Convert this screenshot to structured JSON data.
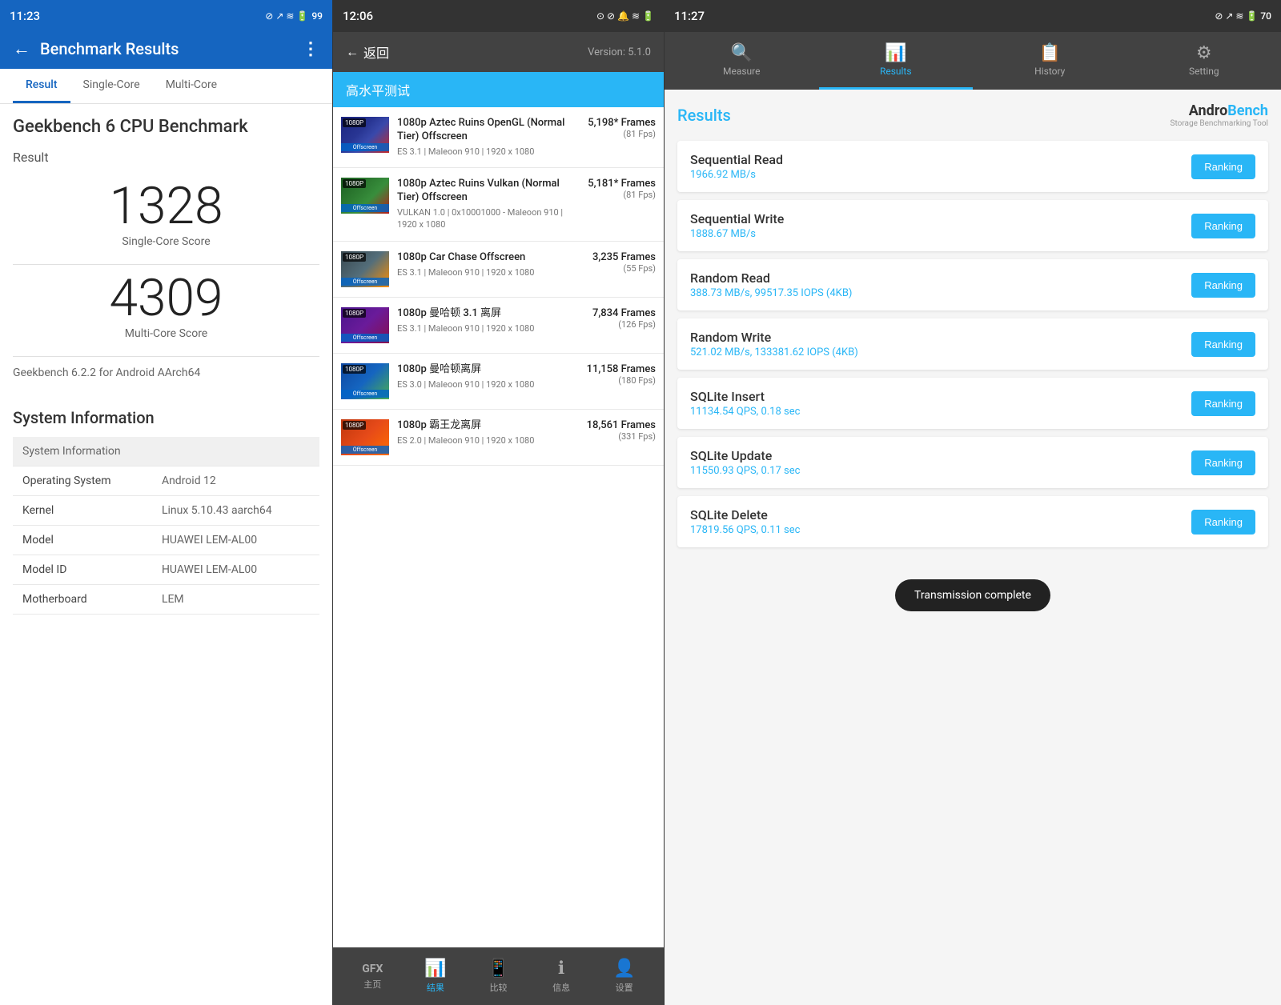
{
  "panel1": {
    "status_bar": {
      "time": "11:23",
      "icons": "⊘ ↗ ≋ 🔋 99"
    },
    "header": {
      "title": "Benchmark Results",
      "back": "←",
      "more": "⋮"
    },
    "tabs": [
      {
        "label": "Result",
        "active": true
      },
      {
        "label": "Single-Core",
        "active": false
      },
      {
        "label": "Multi-Core",
        "active": false
      }
    ],
    "benchmark_title": "Geekbench 6 CPU Benchmark",
    "result_label": "Result",
    "single_core_score": "1328",
    "single_core_label": "Single-Core Score",
    "multi_core_score": "4309",
    "multi_core_label": "Multi-Core Score",
    "version_info": "Geekbench 6.2.2 for Android AArch64",
    "system_info_heading": "System Information",
    "sys_table_header": "System Information",
    "sys_rows": [
      {
        "label": "Operating System",
        "value": "Android 12"
      },
      {
        "label": "Kernel",
        "value": "Linux 5.10.43 aarch64"
      },
      {
        "label": "Model",
        "value": "HUAWEI LEM-AL00"
      },
      {
        "label": "Model ID",
        "value": "HUAWEI LEM-AL00"
      },
      {
        "label": "Motherboard",
        "value": "LEM"
      }
    ]
  },
  "panel2": {
    "status_bar": {
      "time": "12:06",
      "icons": "⊙ ⊘ 🔔 ≋ 🔋 □□"
    },
    "header": {
      "back_label": "返回",
      "version": "Version: 5.1.0"
    },
    "subtitle": "高水平测试",
    "items": [
      {
        "name": "1080p Aztec Ruins OpenGL (Normal Tier) Offscreen",
        "spec": "ES 3.1 | Maleoon 910 | 1920 x 1080",
        "frames": "5,198* Frames",
        "fps": "(81 Fps)",
        "thumb_class": "img-aztec",
        "res": "1080P",
        "tag": "Offscreen"
      },
      {
        "name": "1080p Aztec Ruins Vulkan (Normal Tier) Offscreen",
        "spec": "VULKAN 1.0 | 0x10001000 - Maleoon 910 | 1920 x 1080",
        "frames": "5,181* Frames",
        "fps": "(81 Fps)",
        "thumb_class": "img-aztec2",
        "res": "1080P",
        "tag": "Offscreen"
      },
      {
        "name": "1080p Car Chase Offscreen",
        "spec": "ES 3.1 | Maleoon 910 | 1920 x 1080",
        "frames": "3,235 Frames",
        "fps": "(55 Fps)",
        "thumb_class": "img-car",
        "res": "1080P",
        "tag": "Offscreen"
      },
      {
        "name": "1080p 曼哈顿 3.1 离屏",
        "spec": "ES 3.1 | Maleoon 910 | 1920 x 1080",
        "frames": "7,834 Frames",
        "fps": "(126 Fps)",
        "thumb_class": "img-chinese",
        "res": "1080P",
        "tag": "Offscreen"
      },
      {
        "name": "1080p 曼哈顿离屏",
        "spec": "ES 3.0 | Maleoon 910 | 1920 x 1080",
        "frames": "11,158 Frames",
        "fps": "(180 Fps)",
        "thumb_class": "img-chinese2",
        "res": "1080P",
        "tag": "Offscreen"
      },
      {
        "name": "1080p 霸王龙离屏",
        "spec": "ES 2.0 | Maleoon 910 | 1920 x 1080",
        "frames": "18,561 Frames",
        "fps": "(331 Fps)",
        "thumb_class": "img-dragon",
        "res": "1080P",
        "tag": "Offscreen"
      }
    ],
    "bottom_nav": [
      {
        "label": "主页",
        "icon": "GFX",
        "active": false,
        "is_text": true
      },
      {
        "label": "结果",
        "icon": "📊",
        "active": true
      },
      {
        "label": "比较",
        "icon": "📱",
        "active": false
      },
      {
        "label": "信息",
        "icon": "ℹ",
        "active": false
      },
      {
        "label": "设置",
        "icon": "👤",
        "active": false
      }
    ]
  },
  "panel3": {
    "status_bar": {
      "time": "11:27",
      "icons": "⊘ ↗ ≋ 🔋 70"
    },
    "tabs": [
      {
        "label": "Measure",
        "icon": "🔍",
        "active": false
      },
      {
        "label": "Results",
        "icon": "📊",
        "active": true
      },
      {
        "label": "History",
        "icon": "📋",
        "active": false
      },
      {
        "label": "Setting",
        "icon": "⚙",
        "active": false
      }
    ],
    "results_title": "Results",
    "logo": {
      "main": "AndroBench",
      "sub": "Storage Benchmarking Tool"
    },
    "metrics": [
      {
        "name": "Sequential Read",
        "value": "1966.92 MB/s",
        "btn": "Ranking"
      },
      {
        "name": "Sequential Write",
        "value": "1888.67 MB/s",
        "btn": "Ranking"
      },
      {
        "name": "Random Read",
        "value": "388.73 MB/s, 99517.35 IOPS (4KB)",
        "btn": "Ranking"
      },
      {
        "name": "Random Write",
        "value": "521.02 MB/s, 133381.62 IOPS (4KB)",
        "btn": "Ranking"
      },
      {
        "name": "SQLite Insert",
        "value": "11134.54 QPS, 0.18 sec",
        "btn": "Ranking"
      },
      {
        "name": "SQLite Update",
        "value": "11550.93 QPS, 0.17 sec",
        "btn": "Ranking"
      },
      {
        "name": "SQLite Delete",
        "value": "17819.56 QPS, 0.11 sec",
        "btn": "Ranking"
      }
    ],
    "toast": "Transmission complete"
  }
}
